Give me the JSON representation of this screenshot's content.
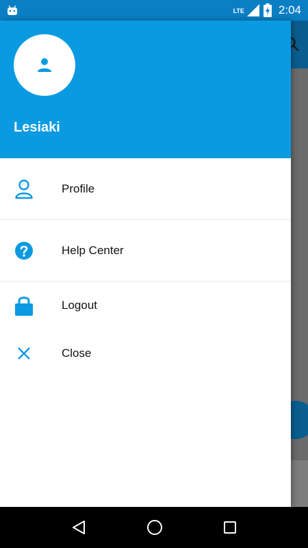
{
  "status_bar": {
    "network": "LTE",
    "time": "2:04"
  },
  "drawer": {
    "username": "Lesiaki",
    "items": [
      {
        "label": "Profile",
        "icon": "person-outline-icon"
      },
      {
        "label": "Help Center",
        "icon": "help-circle-icon"
      },
      {
        "label": "Logout",
        "icon": "lock-icon"
      },
      {
        "label": "Close",
        "icon": "close-icon"
      }
    ]
  },
  "colors": {
    "accent": "#0a9ae2",
    "status_bar": "#0a7fc4"
  }
}
